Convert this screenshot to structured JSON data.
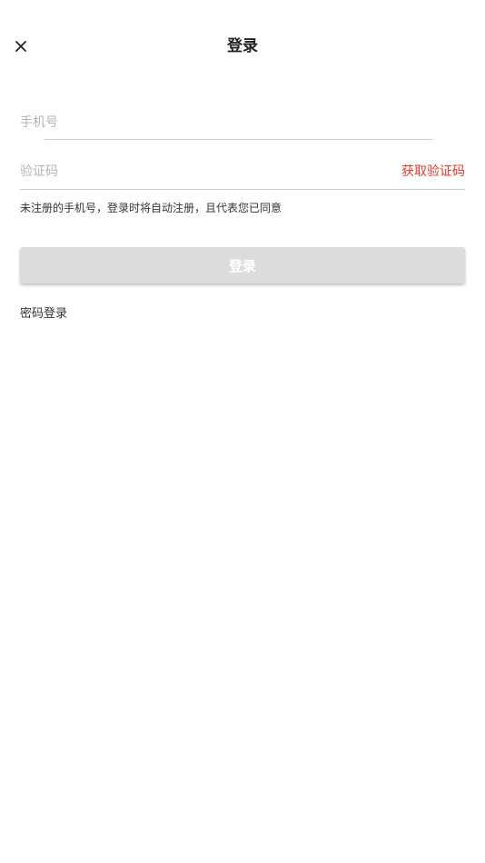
{
  "header": {
    "title": "登录",
    "close_icon": "close-icon"
  },
  "form": {
    "phone": {
      "value": "",
      "placeholder": "手机号"
    },
    "code": {
      "value": "",
      "placeholder": "验证码",
      "get_code_label": "获取验证码"
    },
    "notice": "未注册的手机号，登录时将自动注册，且代表您已同意",
    "login_label": "登录",
    "password_login_label": "密码登录"
  },
  "colors": {
    "accent": "#e8382b",
    "button_disabled": "#dcdcdc",
    "divider": "#cfcfcf"
  }
}
